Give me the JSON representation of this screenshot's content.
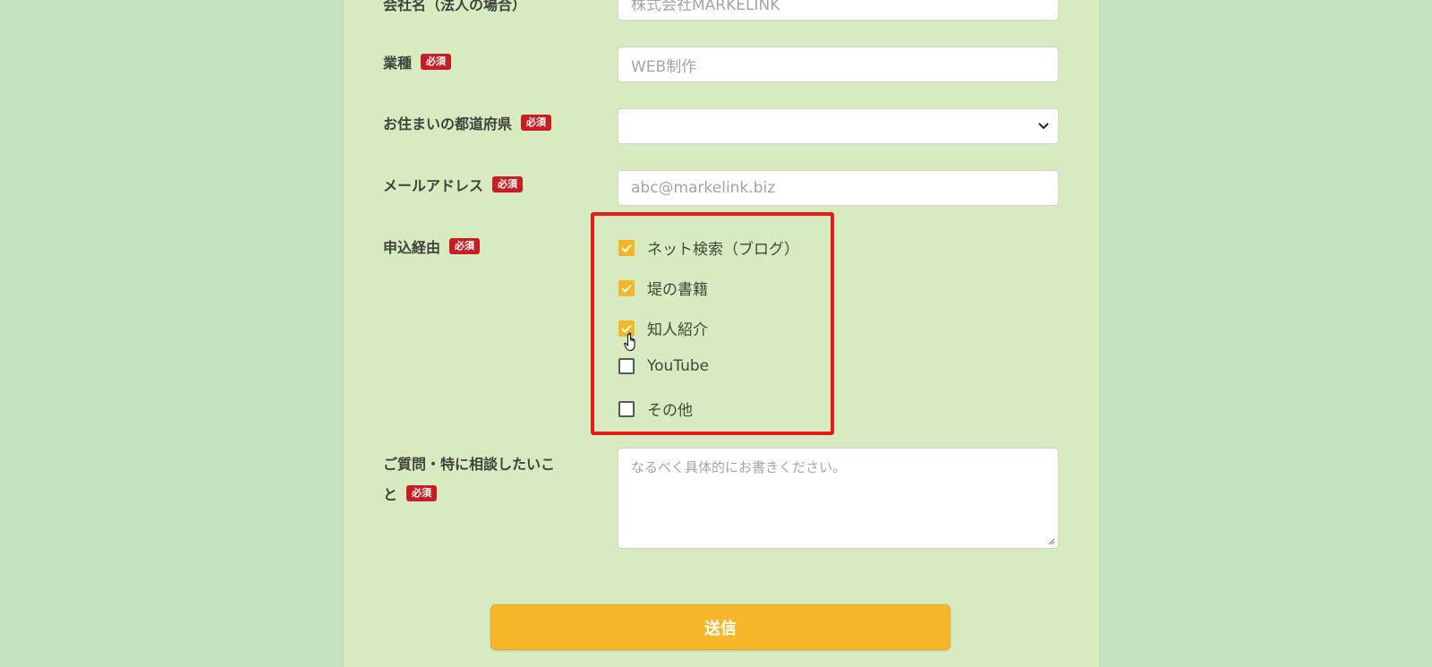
{
  "badge_text": "必須",
  "fields": {
    "company": {
      "label": "会社名（法人の場合）",
      "placeholder": "株式会社MARKELINK"
    },
    "industry": {
      "label": "業種",
      "placeholder": "WEB制作"
    },
    "prefecture": {
      "label": "お住まいの都道府県",
      "value": ""
    },
    "email": {
      "label": "メールアドレス",
      "placeholder": "abc@markelink.biz"
    },
    "source": {
      "label": "申込経由"
    },
    "question": {
      "label_line1": "ご質問・特に相談したいこ",
      "label_line2": "と",
      "placeholder": "なるべく具体的にお書きください。"
    }
  },
  "source_options": [
    {
      "label": "ネット検索（ブログ）",
      "checked": true
    },
    {
      "label": "堤の書籍",
      "checked": true
    },
    {
      "label": "知人紹介",
      "checked": true
    },
    {
      "label": "YouTube",
      "checked": false
    },
    {
      "label": "その他",
      "checked": false
    }
  ],
  "submit_label": "送信",
  "colors": {
    "page_bg": "#c3e4c1",
    "panel_bg": "#d7eac0",
    "badge": "#c81e23",
    "checkbox_checked": "#f5b628",
    "highlight": "#e51a1a",
    "submit": "#f7b72b"
  },
  "icons": {
    "checkmark": "checkmark-icon",
    "cursor": "hand-pointer-icon",
    "chevron": "chevron-down-icon"
  }
}
